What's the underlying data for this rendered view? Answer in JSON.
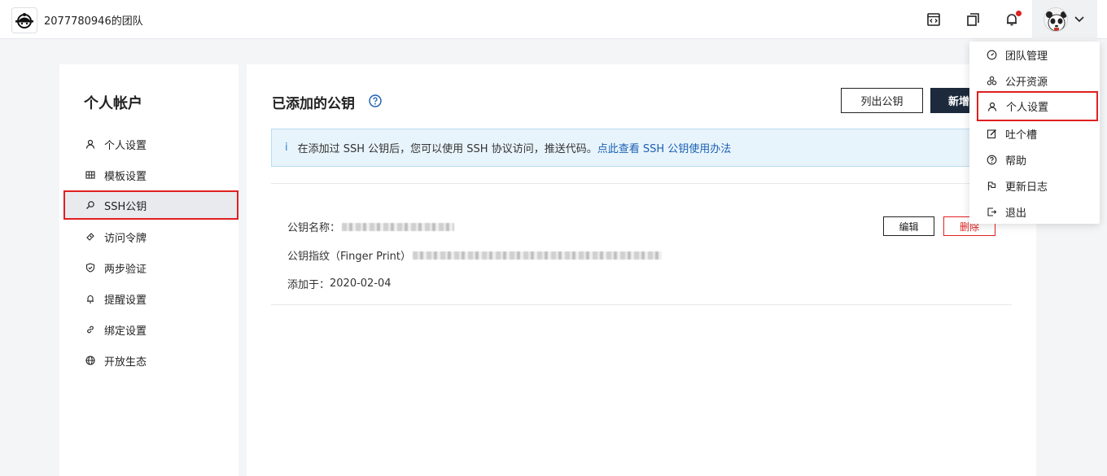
{
  "header": {
    "team_name": "2077780946的团队",
    "icons": [
      "logo-icon",
      "code-icon",
      "window-icon",
      "bell-icon",
      "avatar",
      "chevron-down-icon"
    ]
  },
  "sidebar": {
    "title": "个人帐户",
    "items": [
      {
        "label": "个人设置",
        "icon": "user-icon"
      },
      {
        "label": "模板设置",
        "icon": "grid-icon"
      },
      {
        "label": "SSH公钥",
        "icon": "key-icon",
        "active": true
      },
      {
        "label": "访问令牌",
        "icon": "token-icon"
      },
      {
        "label": "两步验证",
        "icon": "shield-icon"
      },
      {
        "label": "提醒设置",
        "icon": "bell-icon"
      },
      {
        "label": "绑定设置",
        "icon": "link-icon"
      },
      {
        "label": "开放生态",
        "icon": "globe-icon"
      }
    ]
  },
  "main": {
    "title": "已添加的公钥",
    "list_button": "列出公钥",
    "new_button": "新增",
    "info": {
      "prefix": "i",
      "text": "在添加过 SSH 公钥后，您可以使用 SSH 协议访问，推送代码。",
      "link": "点此查看 SSH 公钥使用办法"
    },
    "key": {
      "name_label": "公钥名称：",
      "fingerprint_label": "公钥指纹（Finger Print）",
      "added_label": "添加于：",
      "added_date": "2020-02-04",
      "edit_button": "编辑",
      "delete_button": "删除"
    }
  },
  "dropdown": {
    "items": [
      {
        "label": "团队管理",
        "icon": "dashboard-icon"
      },
      {
        "label": "公开资源",
        "icon": "resources-icon"
      },
      {
        "label": "个人设置",
        "icon": "user-icon",
        "highlight": true
      },
      {
        "label": "吐个槽",
        "icon": "feedback-icon"
      },
      {
        "label": "帮助",
        "icon": "help-icon"
      },
      {
        "label": "更新日志",
        "icon": "flag-icon"
      },
      {
        "label": "退出",
        "icon": "logout-icon"
      }
    ]
  },
  "colors": {
    "highlight_border": "#e02020",
    "primary_button": "#1c2a3c",
    "info_bg": "#e8f4fb",
    "link": "#1a5fb4"
  }
}
